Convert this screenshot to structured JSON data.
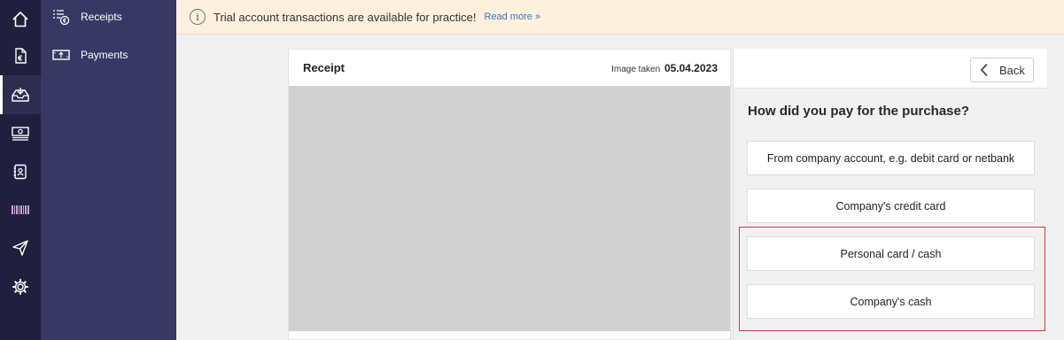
{
  "rail": {
    "items": [
      {
        "icon": "home-icon"
      },
      {
        "icon": "invoice-euro-icon"
      },
      {
        "icon": "inbox-icon",
        "active": true
      },
      {
        "icon": "money-stack-icon"
      },
      {
        "icon": "contact-book-icon"
      },
      {
        "icon": "barcode-icon"
      },
      {
        "icon": "send-icon"
      },
      {
        "icon": "gear-icon"
      }
    ]
  },
  "subnav": {
    "items": [
      {
        "label": "Receipts",
        "icon": "receipts-icon"
      },
      {
        "label": "Payments",
        "icon": "payments-icon"
      }
    ]
  },
  "notice": {
    "message": "Trial account transactions are available for practice!",
    "link": "Read more »"
  },
  "receipt": {
    "title": "Receipt",
    "taken_label": "Image taken",
    "taken_date": "05.04.2023"
  },
  "payment": {
    "back_label": "Back",
    "question": "How did you pay for the purchase?",
    "options": [
      "From company account, e.g. debit card or netbank",
      "Company's credit card",
      "Personal card / cash",
      "Company's cash"
    ]
  },
  "colors": {
    "rail_bg": "#20203e",
    "subnav_bg": "#383864",
    "notice_bg": "#fdf0dc",
    "link": "#3d74c2",
    "highlight": "#d23a3a"
  }
}
